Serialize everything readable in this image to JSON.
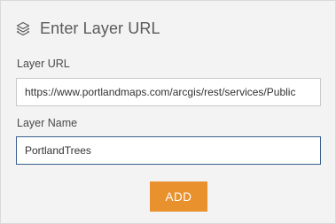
{
  "panel": {
    "title": "Enter Layer URL",
    "header_icon": "layers-icon"
  },
  "layer_url": {
    "label": "Layer URL",
    "value": "https://www.portlandmaps.com/arcgis/rest/services/Public"
  },
  "layer_name": {
    "label": "Layer Name",
    "value": "PortlandTrees"
  },
  "actions": {
    "add_label": "ADD"
  },
  "colors": {
    "accent": "#e8912d",
    "focus_border": "#3a5f8f",
    "panel_bg": "#f3f3f3"
  }
}
